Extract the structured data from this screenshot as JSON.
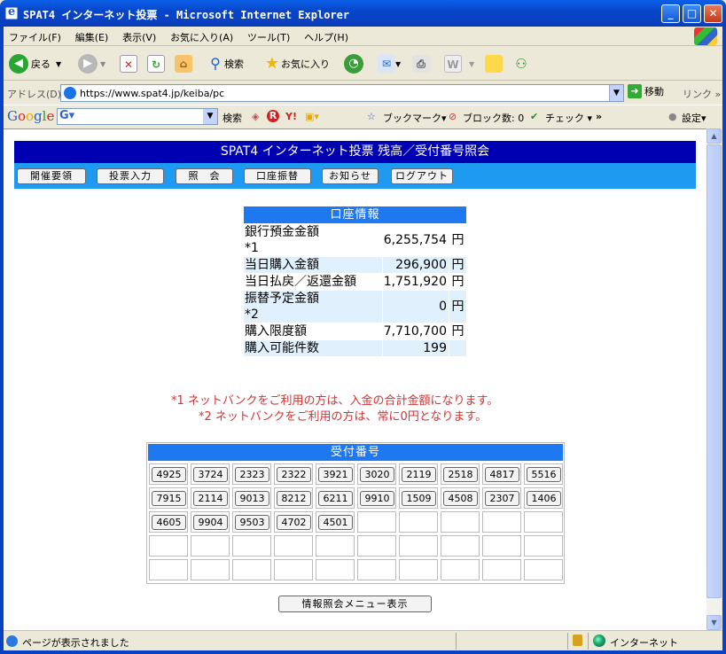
{
  "window": {
    "title": "SPAT4 インターネット投票 - Microsoft Internet Explorer",
    "minimize": "_",
    "maximize": "□",
    "close": "✕"
  },
  "menubar": {
    "items": [
      "ファイル(F)",
      "編集(E)",
      "表示(V)",
      "お気に入り(A)",
      "ツール(T)",
      "ヘルプ(H)"
    ]
  },
  "toolbar": {
    "back": "戻る",
    "search": "検索",
    "favorites": "お気に入り"
  },
  "addressbar": {
    "label": "アドレス(D)",
    "url": "https://www.spat4.jp/keiba/pc",
    "go": "移動",
    "links": "リンク"
  },
  "googlebar": {
    "logo": "Google",
    "search": "検索",
    "bookmarks": "ブックマーク▾",
    "popup_blocked": "ブロック数: 0",
    "check": "チェック ▾",
    "more": "»",
    "settings": "設定▾"
  },
  "page": {
    "header": "SPAT4 インターネット投票 残高／受付番号照会",
    "nav": [
      "開催要領",
      "投票入力",
      "照　会",
      "口座振替",
      "お知らせ",
      "ログアウト"
    ],
    "account": {
      "title": "口座情報",
      "rows": [
        {
          "label": "銀行預金金額",
          "sub": "*1",
          "value": "6,255,754",
          "unit": "円"
        },
        {
          "label": "当日購入金額",
          "sub": "",
          "value": "296,900",
          "unit": "円"
        },
        {
          "label": "当日払戻／返還金額",
          "sub": "",
          "value": "1,751,920",
          "unit": "円"
        },
        {
          "label": "振替予定金額",
          "sub": "*2",
          "value": "0",
          "unit": "円"
        },
        {
          "label": "購入限度額",
          "sub": "",
          "value": "7,710,700",
          "unit": "円"
        },
        {
          "label": "購入可能件数",
          "sub": "",
          "value": "199",
          "unit": ""
        }
      ]
    },
    "notes": [
      "*1 ネットバンクをご利用の方は、入金の合計金額になります。",
      "*2 ネットバンクをご利用の方は、常に0円となります。"
    ],
    "receipts": {
      "title": "受付番号",
      "numbers": [
        "4925",
        "3724",
        "2323",
        "2322",
        "3921",
        "3020",
        "2119",
        "2518",
        "4817",
        "5516",
        "7915",
        "2114",
        "9013",
        "8212",
        "6211",
        "9910",
        "1509",
        "4508",
        "2307",
        "1406",
        "4605",
        "9904",
        "9503",
        "4702",
        "4501"
      ]
    },
    "menu_button": "情報照会メニュー表示"
  },
  "statusbar": {
    "text": "ページが表示されました",
    "zone": "インターネット"
  }
}
